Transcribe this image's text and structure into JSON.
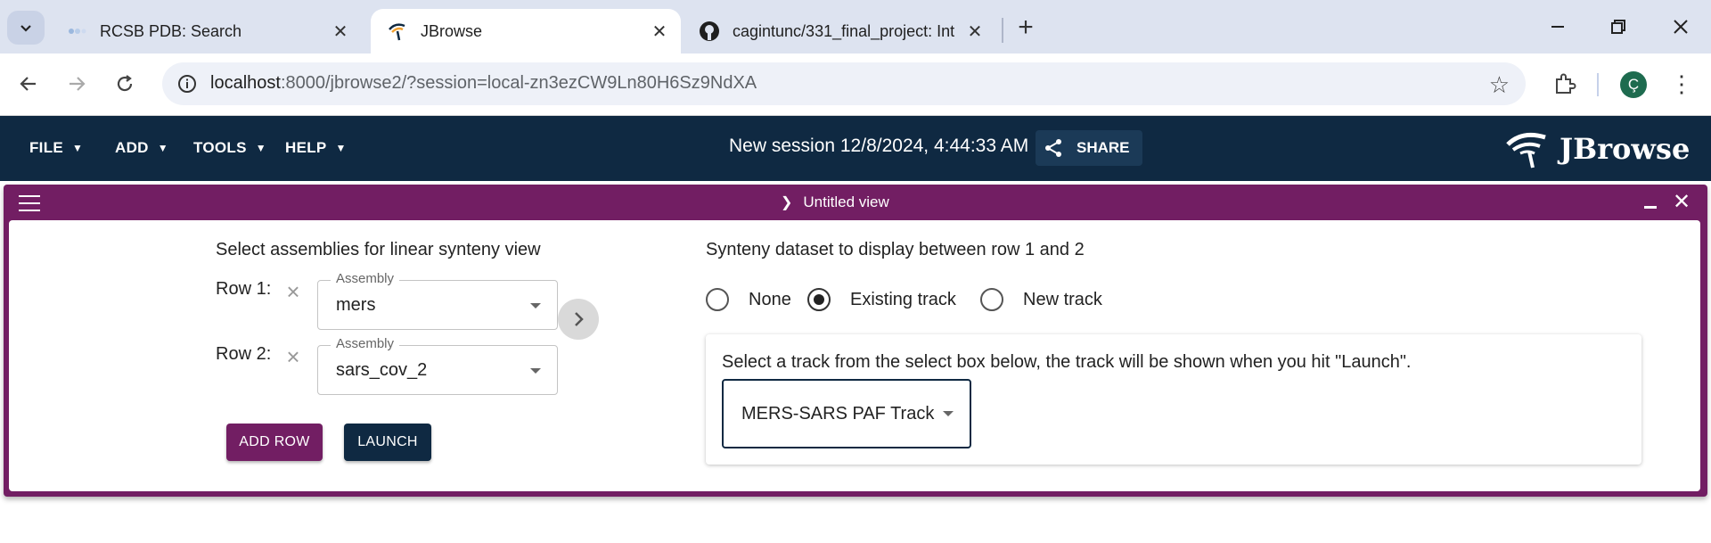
{
  "browser": {
    "tabs": [
      {
        "title": "RCSB PDB: Search",
        "active": false
      },
      {
        "title": "JBrowse",
        "active": true
      },
      {
        "title": "cagintunc/331_final_project: Int",
        "active": false
      }
    ],
    "url_host": "localhost",
    "url_rest": ":8000/jbrowse2/?session=local-zn3ezCW9Ln80H6Sz9NdXA",
    "profile_initial": "Ç"
  },
  "appbar": {
    "menus": [
      "FILE",
      "ADD",
      "TOOLS",
      "HELP"
    ],
    "session_title": "New session 12/8/2024, 4:44:33 AM",
    "share_label": "SHARE",
    "logo_text": "JBrowse",
    "background_color": "#0f2942"
  },
  "view": {
    "title": "Untitled view",
    "header_color": "#721e63",
    "assemblies": {
      "heading": "Select assemblies for linear synteny view",
      "rows": [
        {
          "label": "Row 1:",
          "field_label": "Assembly",
          "value": "mers"
        },
        {
          "label": "Row 2:",
          "field_label": "Assembly",
          "value": "sars_cov_2"
        }
      ],
      "add_row_label": "ADD ROW",
      "launch_label": "LAUNCH"
    },
    "synteny": {
      "heading": "Synteny dataset to display between row 1 and 2",
      "options": [
        {
          "label": "None",
          "checked": false
        },
        {
          "label": "Existing track",
          "checked": true
        },
        {
          "label": "New track",
          "checked": false
        }
      ],
      "hint": "Select a track from the select box below, the track will be shown when you hit \"Launch\".",
      "selected_track": "MERS-SARS PAF Track"
    }
  }
}
